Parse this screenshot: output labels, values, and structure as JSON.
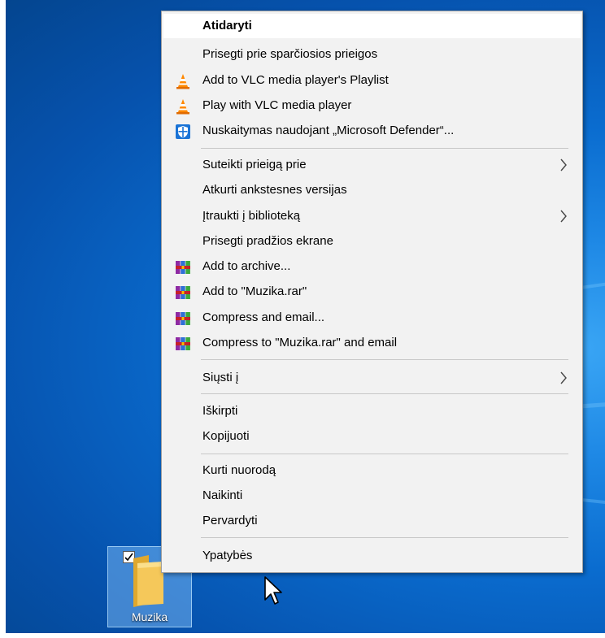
{
  "desktop_icon": {
    "label": "Muzika"
  },
  "menu": {
    "items": [
      {
        "label": "Atidaryti",
        "bold": true,
        "icon": ""
      },
      {
        "label": "Prisegti prie sparčiosios prieigos",
        "icon": ""
      },
      {
        "label": "Add to VLC media player's Playlist",
        "icon": "vlc-icon"
      },
      {
        "label": "Play with VLC media player",
        "icon": "vlc-icon"
      },
      {
        "label": "Nuskaitymas naudojant „Microsoft Defender“...",
        "icon": "defender-icon"
      },
      {
        "label": "Suteikti prieigą prie",
        "icon": "",
        "submenu": true
      },
      {
        "label": "Atkurti ankstesnes versijas",
        "icon": ""
      },
      {
        "label": "Įtraukti į biblioteką",
        "icon": "",
        "submenu": true
      },
      {
        "label": "Prisegti pradžios ekrane",
        "icon": ""
      },
      {
        "label": "Add to archive...",
        "icon": "winrar-icon"
      },
      {
        "label": "Add to \"Muzika.rar\"",
        "icon": "winrar-icon"
      },
      {
        "label": "Compress and email...",
        "icon": "winrar-icon"
      },
      {
        "label": "Compress to \"Muzika.rar\" and email",
        "icon": "winrar-icon"
      },
      {
        "label": "Siųsti į",
        "icon": "",
        "submenu": true
      },
      {
        "label": "Iškirpti",
        "icon": ""
      },
      {
        "label": "Kopijuoti",
        "icon": ""
      },
      {
        "label": "Kurti nuorodą",
        "icon": ""
      },
      {
        "label": "Naikinti",
        "icon": ""
      },
      {
        "label": "Pervardyti",
        "icon": ""
      },
      {
        "label": "Ypatybės",
        "icon": ""
      }
    ]
  }
}
